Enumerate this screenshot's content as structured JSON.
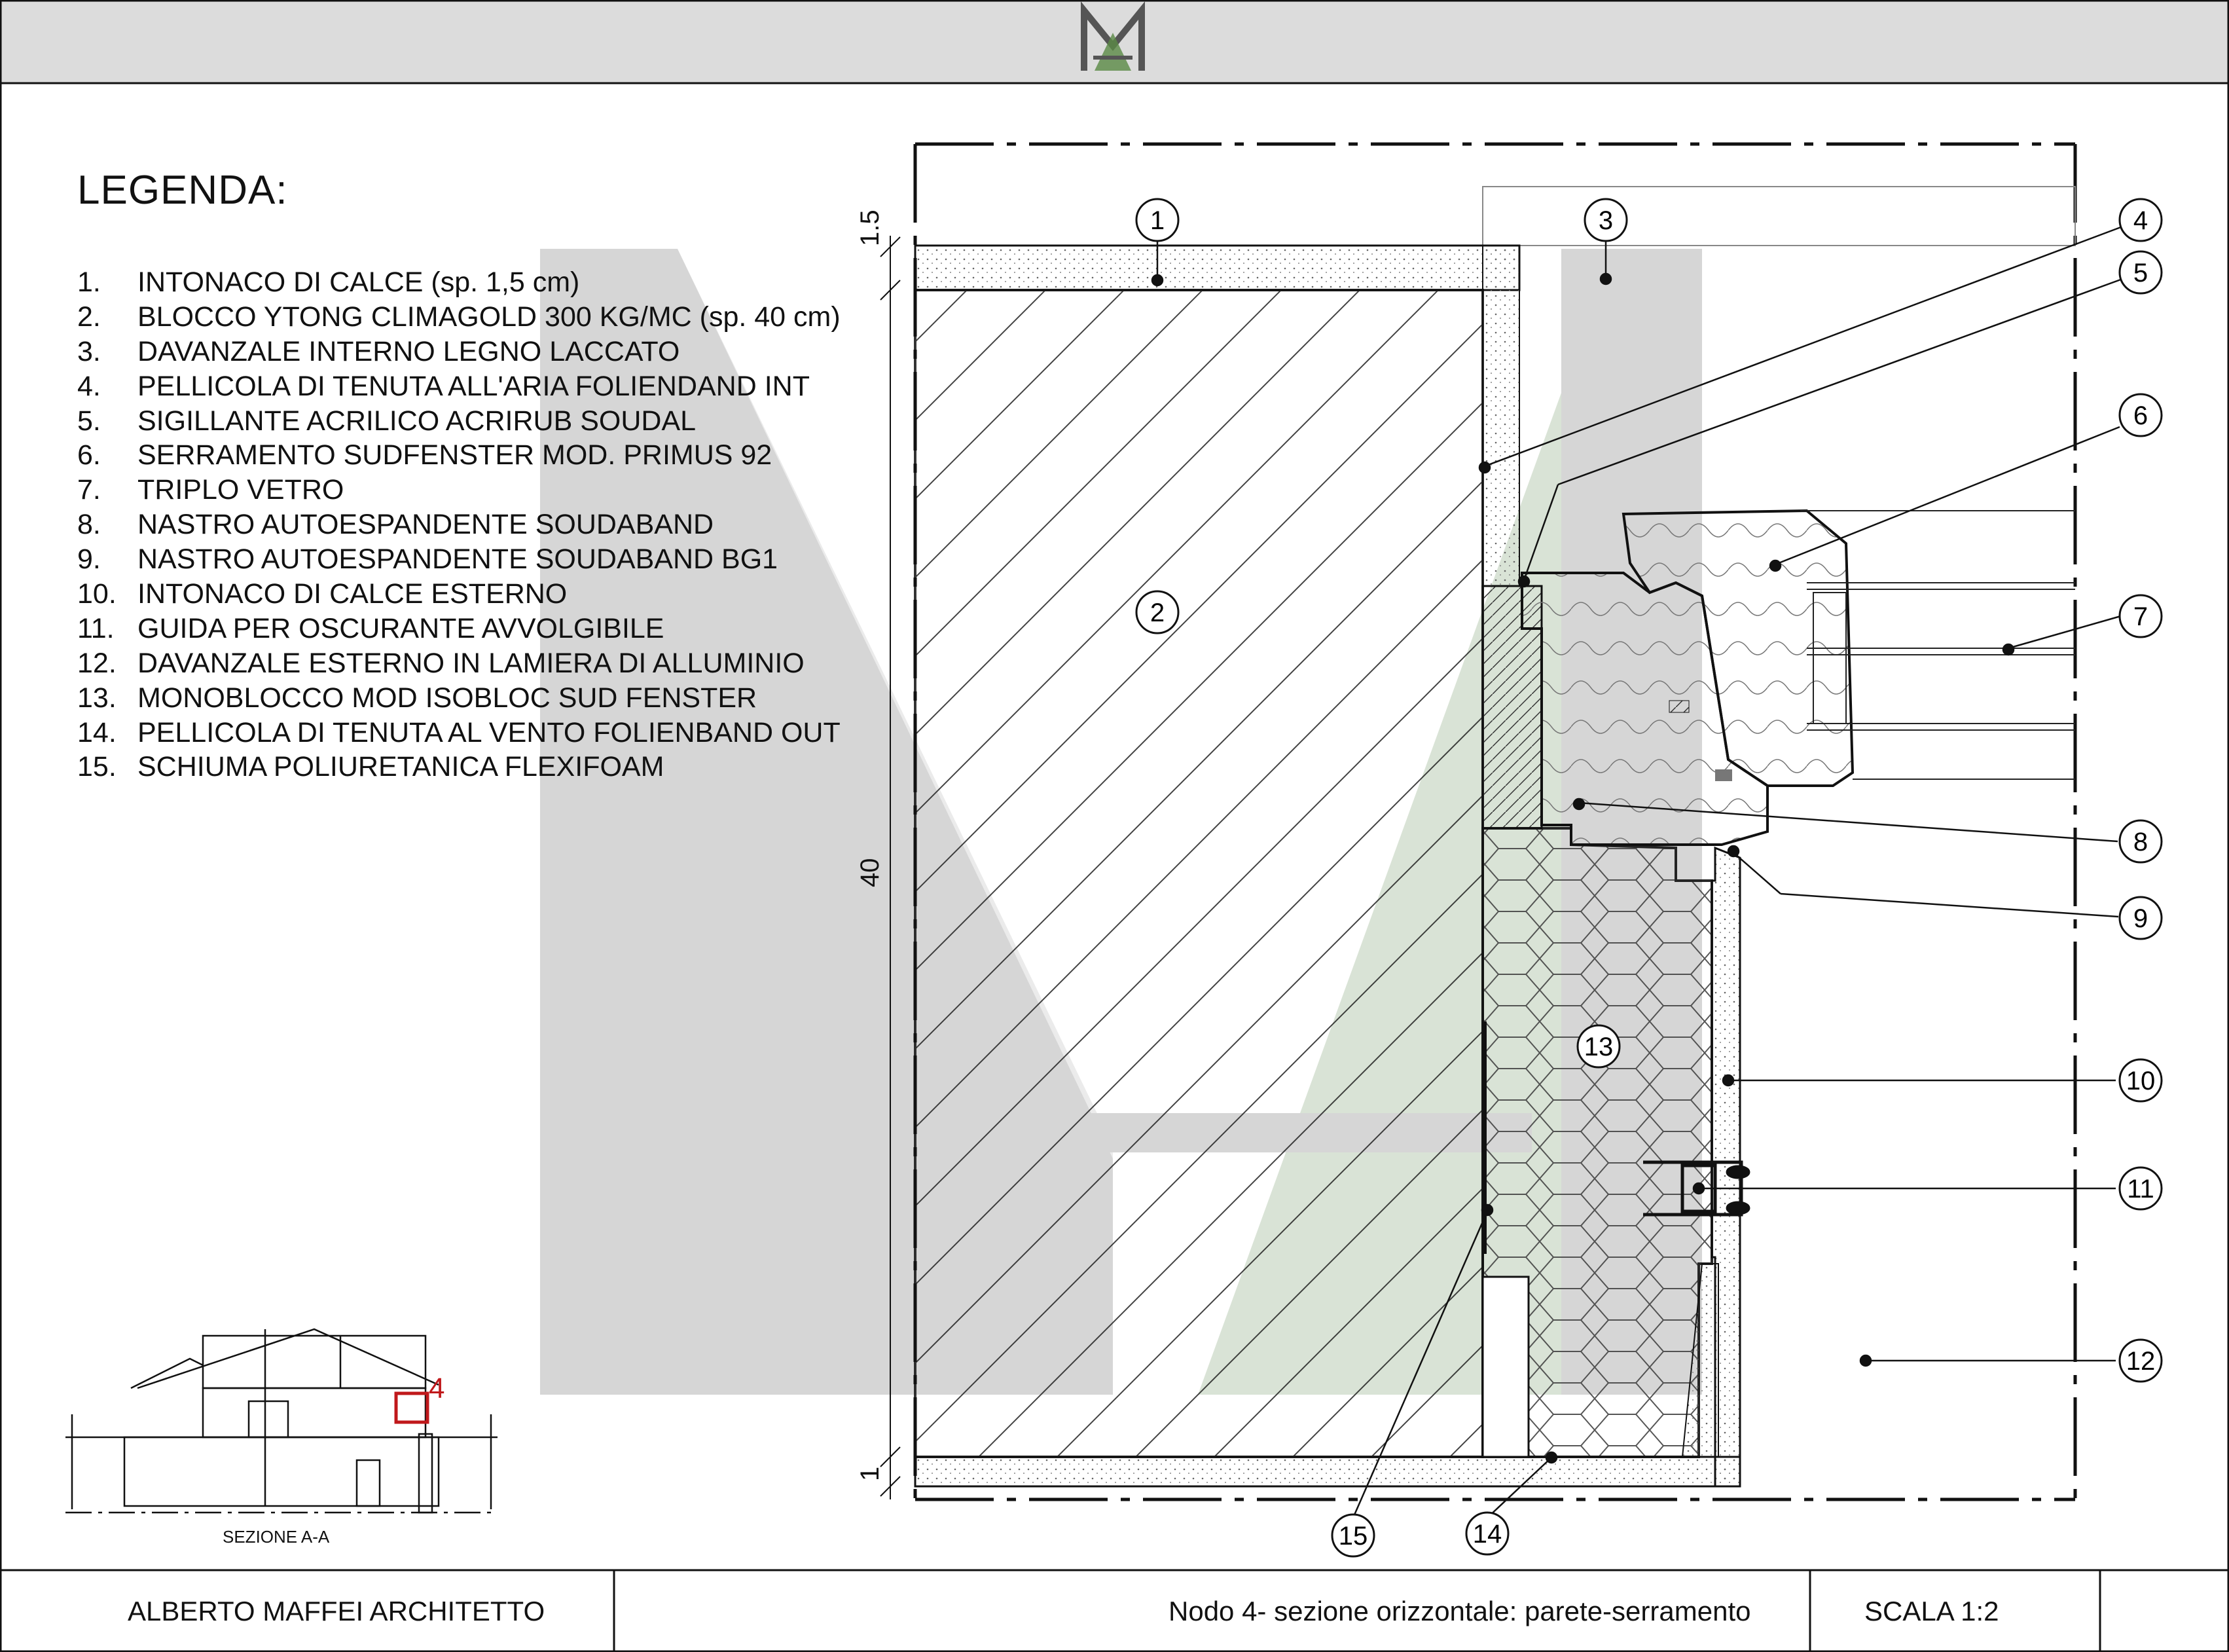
{
  "legend": {
    "title": "LEGENDA:",
    "items": [
      {
        "num": "1.",
        "text": "INTONACO DI CALCE (sp. 1,5 cm)"
      },
      {
        "num": "2.",
        "text": "BLOCCO YTONG CLIMAGOLD 300 KG/MC (sp. 40 cm)"
      },
      {
        "num": "3.",
        "text": "DAVANZALE INTERNO LEGNO LACCATO"
      },
      {
        "num": "4.",
        "text": "PELLICOLA DI TENUTA ALL'ARIA FOLIENDAND INT"
      },
      {
        "num": "5.",
        "text": "SIGILLANTE ACRILICO ACRIRUB SOUDAL"
      },
      {
        "num": "6.",
        "text": "SERRAMENTO SUDFENSTER MOD. PRIMUS 92"
      },
      {
        "num": "7.",
        "text": "TRIPLO VETRO"
      },
      {
        "num": "8.",
        "text": "NASTRO AUTOESPANDENTE SOUDABAND"
      },
      {
        "num": "9.",
        "text": "NASTRO AUTOESPANDENTE SOUDABAND BG1"
      },
      {
        "num": "10.",
        "text": "INTONACO DI CALCE ESTERNO"
      },
      {
        "num": "11.",
        "text": "GUIDA PER OSCURANTE AVVOLGIBILE"
      },
      {
        "num": "12.",
        "text": "DAVANZALE ESTERNO IN LAMIERA DI ALLUMINIO"
      },
      {
        "num": "13.",
        "text": "MONOBLOCCO MOD ISOBLOC  SUD FENSTER"
      },
      {
        "num": "14.",
        "text": "PELLICOLA DI TENUTA AL VENTO FOLIENBAND OUT"
      },
      {
        "num": "15.",
        "text": "SCHIUMA POLIURETANICA FLEXIFOAM"
      }
    ]
  },
  "drawing": {
    "dimensions": {
      "top": "1.5",
      "middle": "40",
      "bottom": "1"
    },
    "callouts": [
      "1",
      "2",
      "3",
      "4",
      "5",
      "6",
      "7",
      "8",
      "9",
      "10",
      "11",
      "12",
      "13",
      "14",
      "15"
    ]
  },
  "key_plan": {
    "caption": "SEZIONE A-A",
    "marker": "4"
  },
  "title_block": {
    "author": "ALBERTO MAFFEI ARCHITETTO",
    "node_title": "Nodo 4- sezione orizzontale: parete-serramento",
    "scale": "SCALA 1:2"
  },
  "colors": {
    "header_bg": "#dcdcdc",
    "watermark_gray": "#d6d6d6",
    "watermark_green": "#d9e3d6",
    "marker_red": "#c0181b",
    "line": "#111111"
  },
  "logo": {
    "letter": "M"
  }
}
